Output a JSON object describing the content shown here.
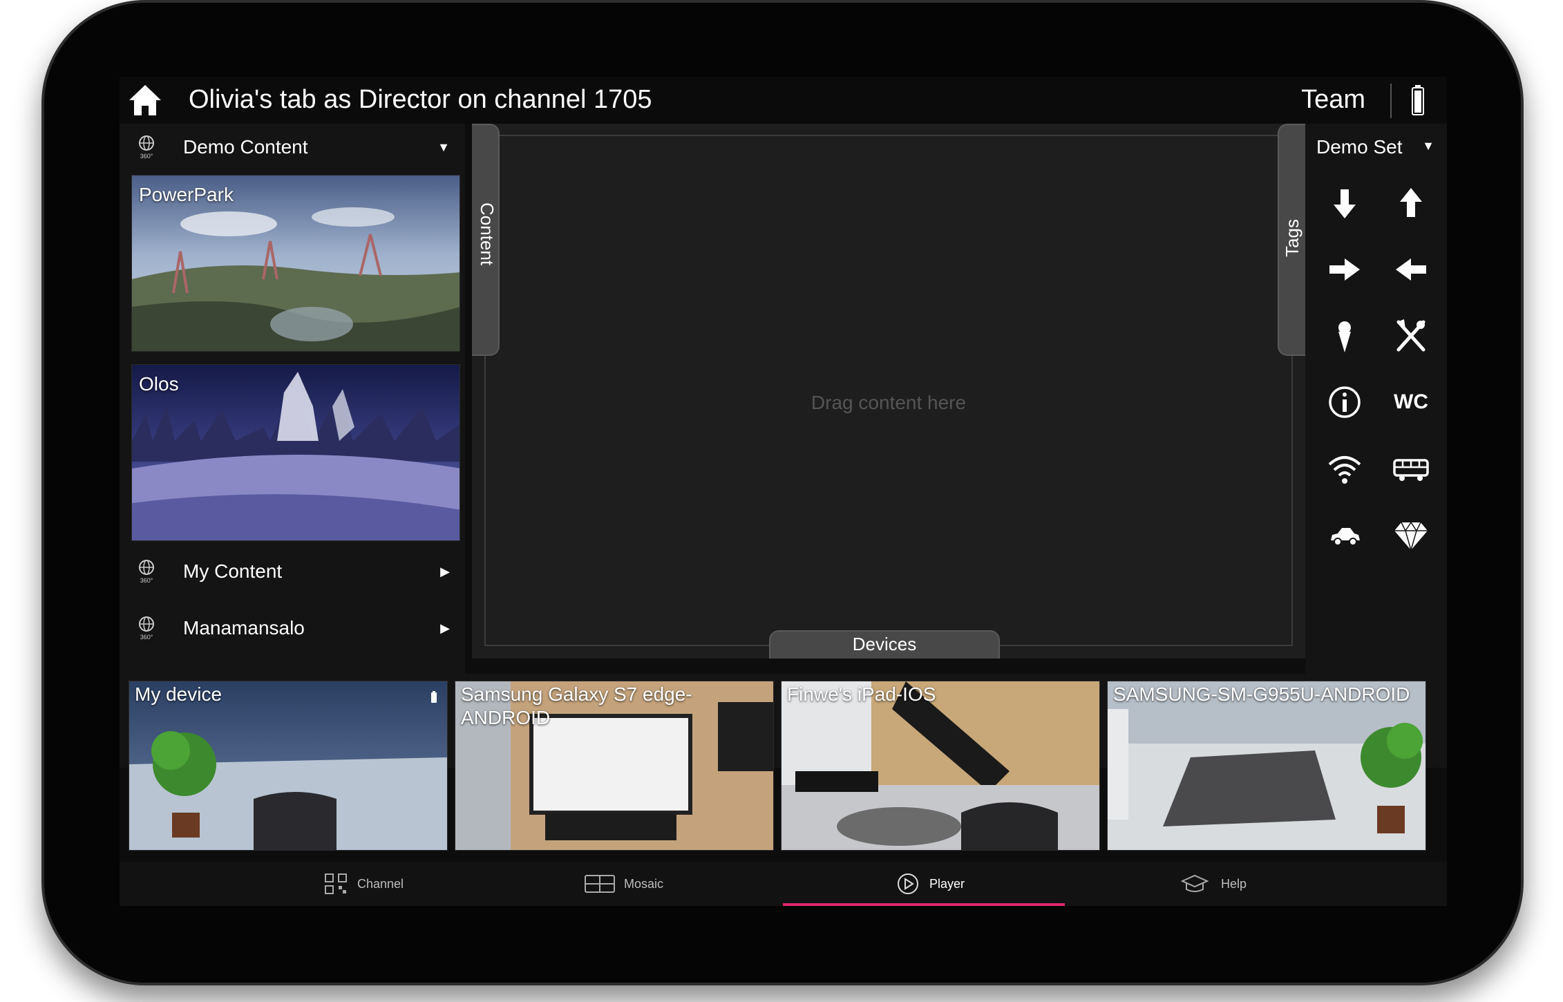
{
  "header": {
    "title": "Olivia's tab as Director on channel 1705",
    "team": "Team"
  },
  "left_panel": {
    "demo_content": {
      "label": "Demo Content",
      "badge": "360°"
    },
    "items": [
      {
        "label": "PowerPark"
      },
      {
        "label": "Olos"
      }
    ],
    "my_content": {
      "label": "My Content",
      "badge": "360°"
    },
    "manamansalo": {
      "label": "Manamansalo",
      "badge": "360°"
    }
  },
  "center": {
    "content_tab": "Content",
    "tags_tab": "Tags",
    "devices_tab": "Devices",
    "drop_placeholder": "Drag content here"
  },
  "tags_panel": {
    "set": "Demo Set",
    "wc": "WC",
    "icons": [
      "arrow-down-icon",
      "arrow-up-icon",
      "arrow-right-icon",
      "arrow-left-icon",
      "ice-cream-icon",
      "fork-knife-icon",
      "info-icon",
      "wc-icon",
      "wifi-icon",
      "bus-icon",
      "car-icon",
      "diamond-icon"
    ]
  },
  "devices": [
    {
      "name": "My device"
    },
    {
      "name": "Samsung Galaxy S7 edge-ANDROID"
    },
    {
      "name": "Finwe's iPad-IOS"
    },
    {
      "name": "SAMSUNG-SM-G955U-ANDROID"
    }
  ],
  "nav": {
    "channel": "Channel",
    "mosaic": "Mosaic",
    "player": "Player",
    "help": "Help",
    "active": "Player"
  },
  "colors": {
    "accent": "#e0266e",
    "screen_bg": "#0d0d0d",
    "panel_bg": "#141414",
    "center_bg": "#1e1e1e"
  }
}
